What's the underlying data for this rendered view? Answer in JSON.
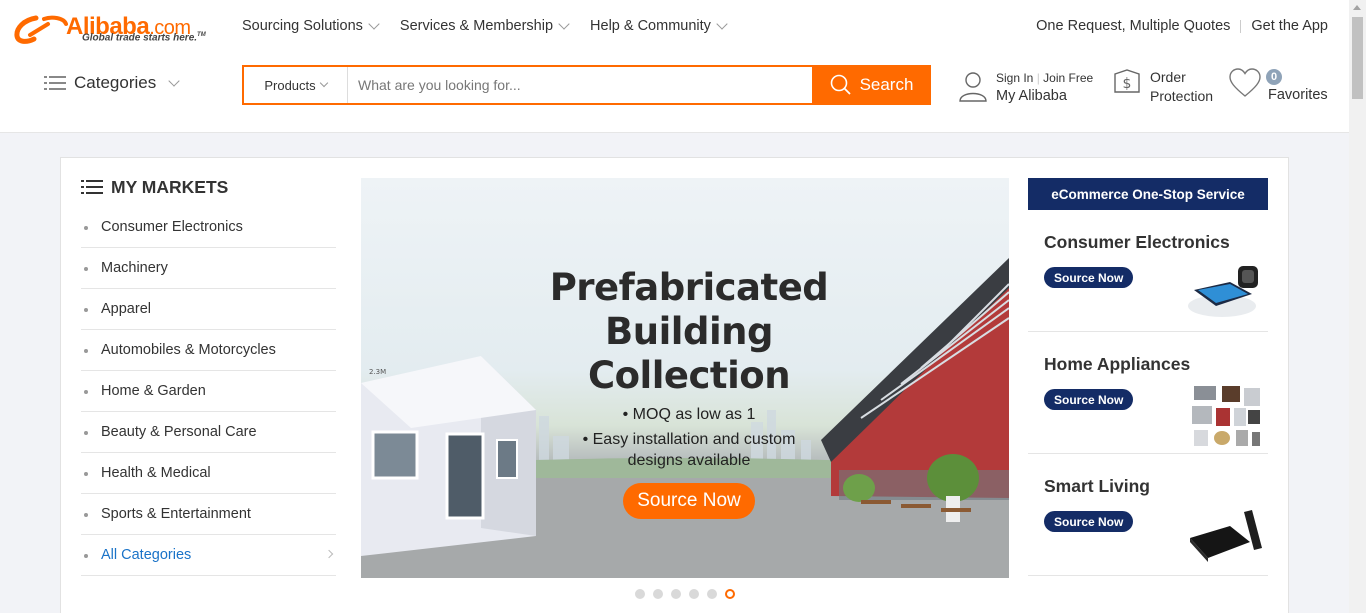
{
  "header": {
    "logo_word": "Alibaba",
    "logo_com": ".com",
    "logo_tagline": "Global trade starts here.",
    "logo_tm": "TM",
    "nav": [
      "Sourcing Solutions",
      "Services & Membership",
      "Help & Community"
    ],
    "quotes_link": "One Request, Multiple Quotes",
    "app_link": "Get the App",
    "categories_label": "Categories",
    "search": {
      "scope": "Products",
      "placeholder": "What are you looking for...",
      "button": "Search"
    },
    "account": {
      "sign_in": "Sign In",
      "join": "Join Free",
      "my_alibaba": "My Alibaba"
    },
    "order_protection": [
      "Order",
      "Protection"
    ],
    "favorites": {
      "label": "Favorites",
      "count": "0"
    }
  },
  "markets": {
    "title": "MY MARKETS",
    "items": [
      "Consumer Electronics",
      "Machinery",
      "Apparel",
      "Automobiles & Motorcycles",
      "Home & Garden",
      "Beauty & Personal Care",
      "Health & Medical",
      "Sports & Entertainment"
    ],
    "all": "All Categories"
  },
  "banner": {
    "title_line1": "Prefabricated",
    "title_line2": "Building Collection",
    "bullet1": "• MOQ as low as 1",
    "bullet2": "• Easy installation and custom",
    "bullet3": "designs available",
    "button": "Source Now",
    "sign_text": "2.3M",
    "slide_count": 6,
    "active_slide": 6
  },
  "ecommerce": {
    "heading": "eCommerce One-Stop Service",
    "cards": [
      {
        "title": "Consumer Electronics",
        "button": "Source Now"
      },
      {
        "title": "Home Appliances",
        "button": "Source Now"
      },
      {
        "title": "Smart Living",
        "button": "Source Now"
      }
    ]
  },
  "colors": {
    "brand_orange": "#ff6a00",
    "navy": "#142c66",
    "link_blue": "#1a73c8"
  }
}
